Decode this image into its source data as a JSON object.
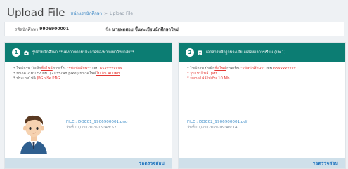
{
  "header": {
    "title": "Upload File",
    "breadcrumb_link": "หน้าแรกนักศึกษา",
    "breadcrumb_sep": ">",
    "breadcrumb_current": "Upload File"
  },
  "student": {
    "id_label": "รหัสนักศึกษา",
    "id_value": "9906900001",
    "name_label": "ชื่อ",
    "name_value": "นายทดสอบ ขึ้นทะเบียนนักศึกษาใหม่"
  },
  "cards": [
    {
      "number": "1",
      "icon": "camera-icon",
      "title": "รูปถ่ายนักศึกษา **แต่งกายตามประกาศของทางมหาวิทยาลัย**",
      "rule1_a": "* ไฟล์ภาพ บันทึก",
      "rule1_u": "ชื่อไฟล์",
      "rule1_b": "ภาพเป็น",
      "rule1_red": "\"รหัสนักศึกษา\"",
      "rule1_c": " เช่น ",
      "rule1_ex": "65xxxxxxxx",
      "rule2_a": "* ขนาด 2 ซม.*2 ซม. (213*248 pixel) ขนาดไฟล์",
      "rule2_u": "ไม่เกิน 400KB",
      "rule3_a": "* ประเภทไฟล์ ",
      "rule3_red": "JPG หรือ PNG",
      "file_name": "FILE : DOC01_9906900001.png",
      "file_date": "วันที่ 01/21/2026 09:48:57",
      "status": "รอตรวจสอบ"
    },
    {
      "number": "2",
      "icon": "document-icon",
      "title": "เอกสารหลักฐานระเบียนแสดงผลการเรียน (ปพ.1)",
      "rule1_a": "* ไฟล์ภาพ บันทึก",
      "rule1_u": "ชื่อไฟล์",
      "rule1_b": "ภาพเป็น",
      "rule1_red": "\"รหัสนักศึกษา\"",
      "rule1_c": " เช่น ",
      "rule1_ex": "65xxxxxxxx",
      "rule2_red": "* รูปแบบไฟล์ .pdf",
      "rule3_red": "* ขนาดไฟล์ไม่เกิน 10 Mb",
      "file_name": "FILE : DOC02_9906900001.pdf",
      "file_date": "วันที่ 01/21/2026 09:46:14",
      "status": "รอตรวจสอบ"
    }
  ],
  "colors": {
    "header_teal": "#0c7d73",
    "footer_blue": "#cfe0ea",
    "accent_red": "#e53935",
    "link_blue": "#3f8ec9"
  }
}
